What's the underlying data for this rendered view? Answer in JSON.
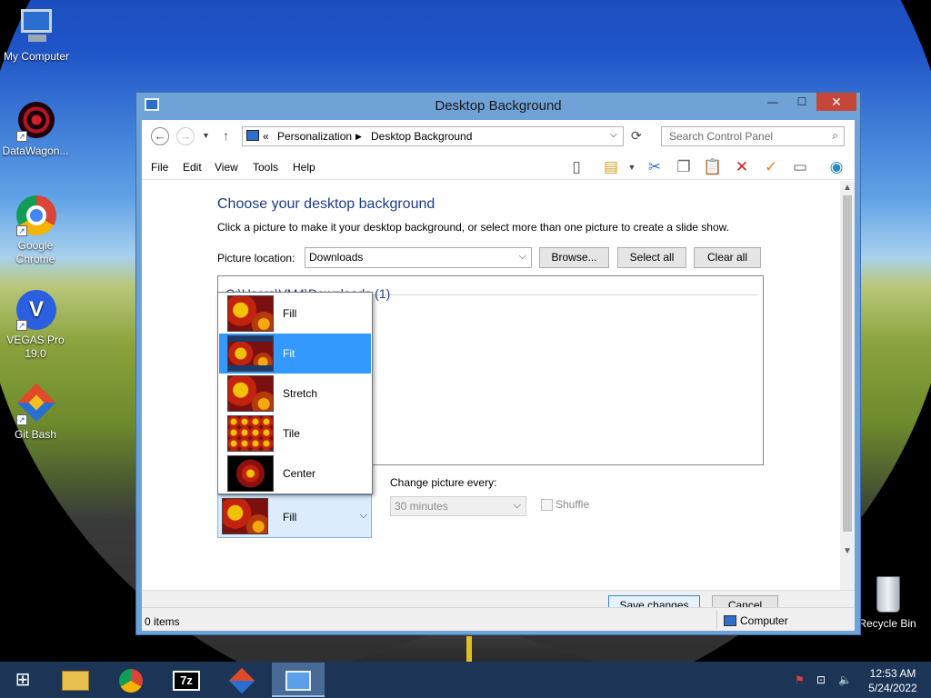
{
  "desktop": {
    "icons": [
      {
        "label": "My Computer",
        "icon": "computer-icon"
      },
      {
        "label": "DataWagon...",
        "icon": "datawagon-icon"
      },
      {
        "label": "Google Chrome",
        "icon": "chrome-icon"
      },
      {
        "label": "VEGAS Pro 19.0",
        "icon": "vegas-icon"
      },
      {
        "label": "Git Bash",
        "icon": "git-icon"
      },
      {
        "label": "Recycle Bin",
        "icon": "recycle-bin-icon"
      }
    ]
  },
  "window": {
    "title": "Desktop Background",
    "controls": {
      "minimize": "—",
      "maximize": "☐",
      "close": "✕"
    }
  },
  "address": {
    "breadcrumbs": [
      "Personalization",
      "Desktop Background"
    ],
    "overflow": "«",
    "search_placeholder": "Search Control Panel"
  },
  "menu": [
    "File",
    "Edit",
    "View",
    "Tools",
    "Help"
  ],
  "content": {
    "heading": "Choose your desktop background",
    "subtext": "Click a picture to make it your desktop background, or select more than one picture to create a slide show.",
    "picture_location_label": "Picture location:",
    "picture_location_value": "Downloads",
    "browse": "Browse...",
    "select_all": "Select all",
    "clear_all": "Clear all",
    "gallery_title": "C:\\Users\\VM4\\Downloads (1)",
    "change_every_label": "Change picture every:",
    "change_every_value": "30 minutes",
    "shuffle_label": "Shuffle",
    "position_selected": "Fill",
    "position_options": [
      "Fill",
      "Fit",
      "Stretch",
      "Tile",
      "Center"
    ],
    "position_highlighted": "Fit"
  },
  "footer": {
    "save": "Save changes",
    "cancel": "Cancel"
  },
  "status": {
    "items": "0 items",
    "location": "Computer"
  },
  "taskbar": {
    "apps": [
      "file-explorer-icon",
      "chrome-icon",
      "7zip-icon",
      "git-icon",
      "control-panel-icon"
    ],
    "time": "12:53 AM",
    "date": "5/24/2022"
  },
  "colors": {
    "accent": "#3399ff",
    "heading": "#1e3b8c",
    "titlebar": "#6fa3d8",
    "close": "#c7463a",
    "taskbar": "#1c3556"
  }
}
